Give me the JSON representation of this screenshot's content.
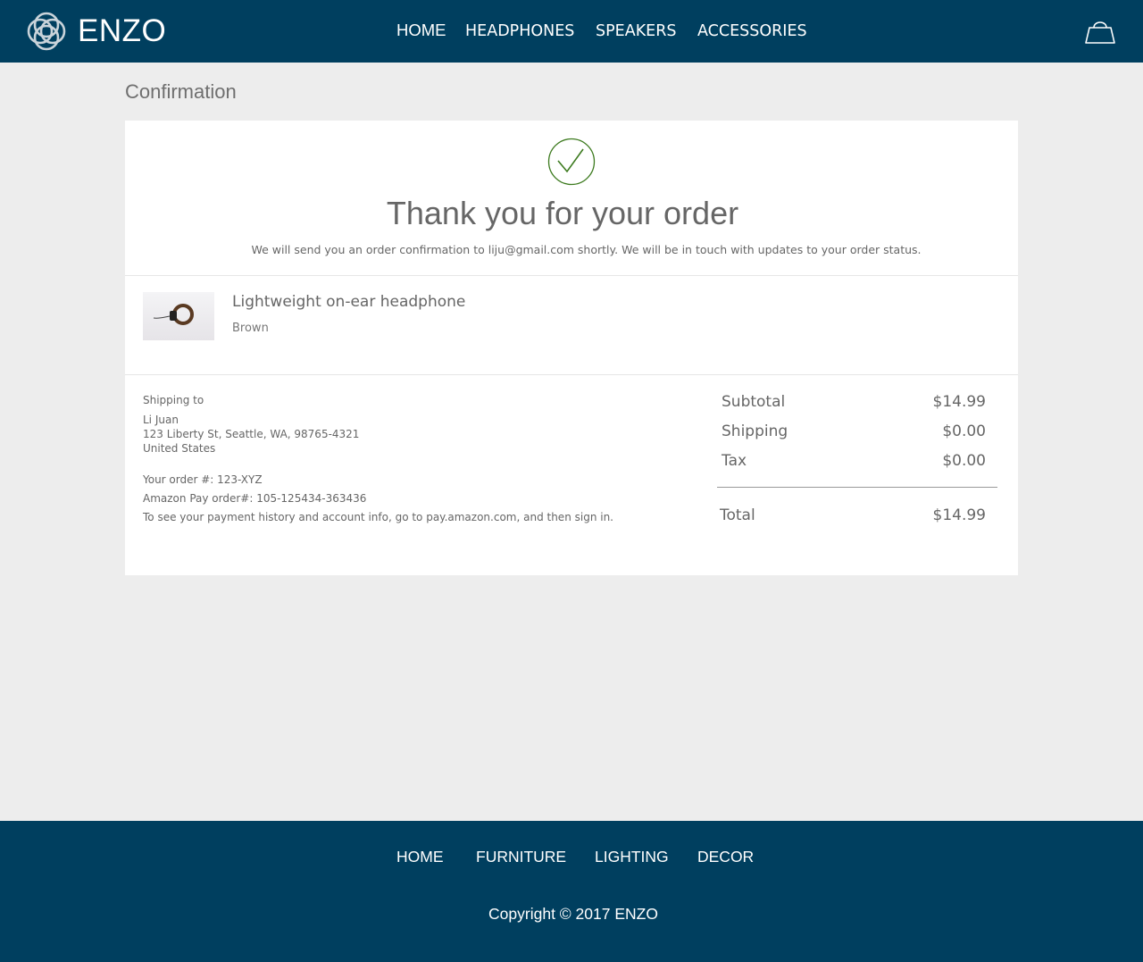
{
  "header": {
    "brand": "ENZO",
    "nav": [
      "HOME",
      "HEADPHONES",
      "SPEAKERS",
      "ACCESSORIES"
    ]
  },
  "page": {
    "title": "Confirmation"
  },
  "confirmation": {
    "heading": "Thank you for your order",
    "message": "We will send you an order confirmation to liju@gmail.com shortly. We will be in touch with updates to your order status."
  },
  "product": {
    "name": "Lightweight on-ear headphone",
    "color": "Brown"
  },
  "shipping": {
    "label": "Shipping to",
    "name": "Li Juan",
    "street": "123 Liberty St, Seattle, WA, 98765-4321",
    "country": "United States"
  },
  "order": {
    "order_number": "Your order #: 123-XYZ",
    "amazon_pay_order": "Amazon Pay order#: 105-125434-363436",
    "payment_note": "To see your payment history and account info, go to pay.amazon.com, and then sign in."
  },
  "summary": {
    "subtotal_label": "Subtotal",
    "subtotal": "$14.99",
    "shipping_label": "Shipping",
    "shipping": "$0.00",
    "tax_label": "Tax",
    "tax": "$0.00",
    "total_label": "Total",
    "total": "$14.99"
  },
  "footer": {
    "nav": [
      "HOME",
      "FURNITURE",
      "LIGHTING",
      "DECOR"
    ],
    "copyright": "Copyright © 2017 ENZO"
  },
  "colors": {
    "header_bg": "#003f5f",
    "page_bg": "#ededed",
    "check_green": "#3c7a1e"
  }
}
